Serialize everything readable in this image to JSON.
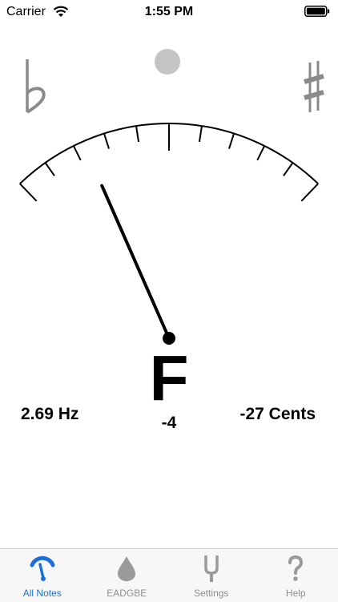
{
  "status_bar": {
    "carrier": "Carrier",
    "time": "1:55 PM"
  },
  "tuner": {
    "note": "F",
    "octave": "-4",
    "frequency": "2.69 Hz",
    "cents": "-27 Cents",
    "needle_cents": -27,
    "flat_icon": "flat-icon",
    "sharp_icon": "sharp-icon",
    "in_tune_indicator_color": "#c4c4c4"
  },
  "tab_bar": {
    "tabs": [
      {
        "label": "All Notes",
        "icon": "gauge-icon",
        "active": true
      },
      {
        "label": "EADGBE",
        "icon": "drop-icon",
        "active": false
      },
      {
        "label": "Settings",
        "icon": "tuning-fork-icon",
        "active": false
      },
      {
        "label": "Help",
        "icon": "question-icon",
        "active": false
      }
    ],
    "active_color": "#1d6fd8",
    "inactive_color": "#8e8e93"
  }
}
